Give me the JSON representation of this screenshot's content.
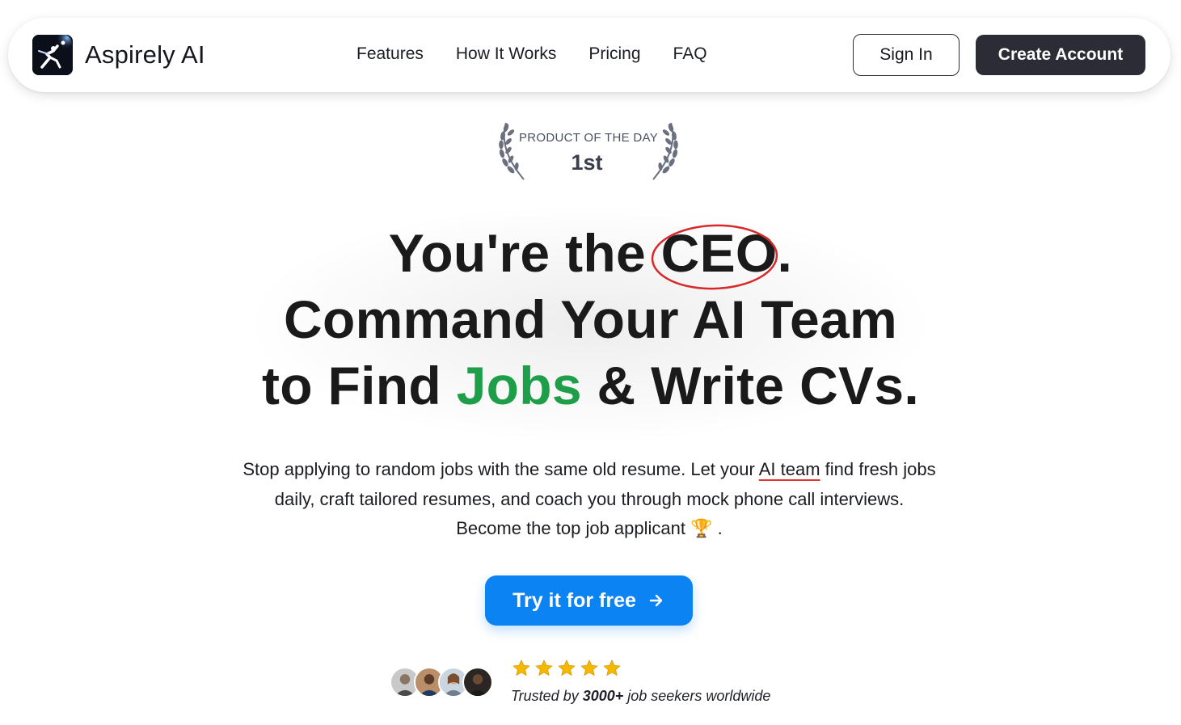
{
  "nav": {
    "brand": "Aspirely AI",
    "links": [
      "Features",
      "How It Works",
      "Pricing",
      "FAQ"
    ],
    "sign_in": "Sign In",
    "create_account": "Create Account"
  },
  "award": {
    "title": "PRODUCT OF THE DAY",
    "rank": "1st"
  },
  "headline": {
    "line1_pre": "You're the ",
    "line1_highlight": "CEO",
    "line1_post": ".",
    "line2": "Command Your AI Team",
    "line3_pre": "to Find ",
    "line3_highlight": "Jobs",
    "line3_post": " & Write CVs."
  },
  "subtext": {
    "part1": "Stop applying to random jobs with the same old resume. Let your ",
    "link": "AI team",
    "part2": " find fresh jobs daily, craft tailored resumes, and coach you through mock phone call interviews. Become the top job applicant ",
    "emoji": "🏆",
    "end": " ."
  },
  "cta": {
    "label": "Try it for free",
    "icon": "arrow-right-icon"
  },
  "social_proof": {
    "rating": 5,
    "prefix": "Trusted by ",
    "count": "3000+",
    "suffix": " job seekers worldwide"
  },
  "colors": {
    "accent_blue": "#0c83f3",
    "accent_green": "#1e9e48",
    "circle_red": "#d8282a",
    "dark_button": "#2b2c36",
    "star": "#f5b800"
  }
}
